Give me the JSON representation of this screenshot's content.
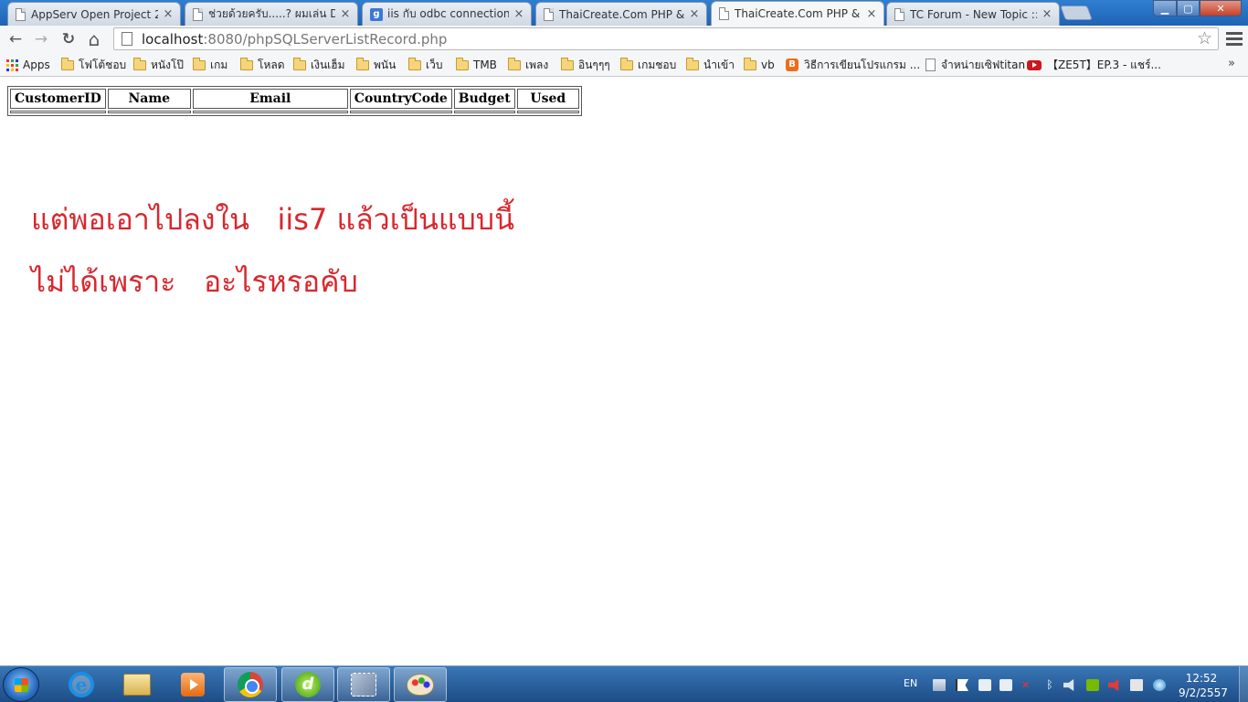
{
  "tabs": [
    {
      "label": "AppServ Open Project 2.5",
      "icon": "page-icon"
    },
    {
      "label": "ช่วยด้วยครับ.....? ผมเล่น Dr",
      "icon": "page-icon"
    },
    {
      "label": "iis กับ odbc connection - ",
      "icon": "google-icon",
      "icon_letter": "g"
    },
    {
      "label": "ThaiCreate.Com PHP & S(",
      "icon": "page-icon"
    },
    {
      "label": "ThaiCreate.Com PHP & S(",
      "icon": "page-icon",
      "active": true
    },
    {
      "label": "TC Forum - New Topic :: ",
      "icon": "page-icon"
    }
  ],
  "tab_close_glyph": "×",
  "window": {
    "minimize": "▁",
    "maximize": "▢",
    "close": "✕"
  },
  "toolbar": {
    "back": "←",
    "forward": "→",
    "reload": "↻",
    "home": "⌂",
    "star": "☆"
  },
  "address": {
    "host": "localhost",
    "path": ":8080/phpSQLServerListRecord.php"
  },
  "bookmarks": [
    {
      "label": "Apps",
      "icon": "apps-icon"
    },
    {
      "label": "โฟโต้ชอบ",
      "icon": "folder-icon"
    },
    {
      "label": "หนังโป๊",
      "icon": "folder-icon"
    },
    {
      "label": "เกม",
      "icon": "folder-icon"
    },
    {
      "label": "โหลด",
      "icon": "folder-icon"
    },
    {
      "label": "เงินเฮ็ม",
      "icon": "folder-icon"
    },
    {
      "label": "พนัน",
      "icon": "folder-icon"
    },
    {
      "label": "เว็บ",
      "icon": "folder-icon"
    },
    {
      "label": "TMB",
      "icon": "folder-icon"
    },
    {
      "label": "เพลง",
      "icon": "folder-icon"
    },
    {
      "label": "อินๆๆๆ",
      "icon": "folder-icon"
    },
    {
      "label": "เกมชอบ",
      "icon": "folder-icon"
    },
    {
      "label": "นำเข้า",
      "icon": "folder-icon"
    },
    {
      "label": "vb",
      "icon": "folder-icon"
    },
    {
      "label": "วิธีการเขียนโปรแกรม ...",
      "icon": "blogger-icon"
    },
    {
      "label": "จำหน่ายเซิฟtitan",
      "icon": "page-icon"
    },
    {
      "label": "【ZE5T】EP.3 - แชร์...",
      "icon": "youtube-icon"
    }
  ],
  "bookmarks_more": "»",
  "table": {
    "headers": [
      "CustomerID",
      "Name",
      "Email",
      "CountryCode",
      "Budget",
      "Used"
    ]
  },
  "note": {
    "line1": "แต่พอเอาไปลงใน   iis7 แล้วเป็นแบบนี้",
    "line2": "ไม่ได้เพราะ   อะไรหรอคับ",
    "color": "#d9272e"
  },
  "taskbar": {
    "pinned": [
      "internet-explorer-icon",
      "file-explorer-icon",
      "media-player-icon",
      "chrome-icon",
      "dreamweaver-icon",
      "tools-icon",
      "paint-icon"
    ],
    "ie_letter": "e",
    "dw_letter": "d",
    "language": "EN",
    "bluetooth_glyph": "ᛒ",
    "red_x_glyph": "✕",
    "time": "12:52",
    "date": "9/2/2557"
  }
}
